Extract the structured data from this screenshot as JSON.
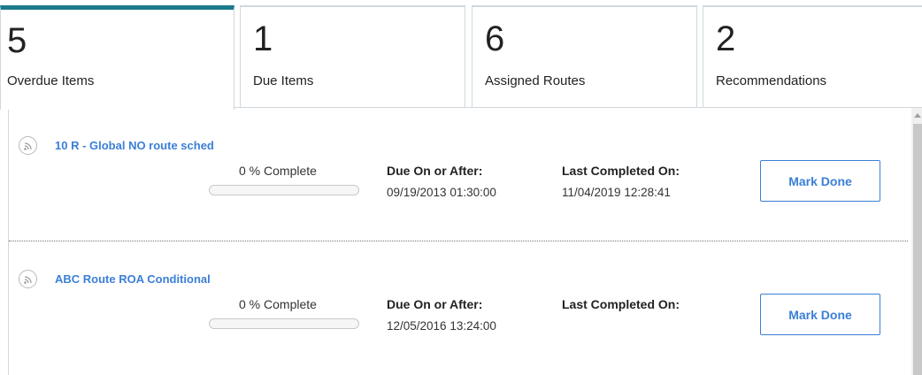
{
  "tabs": [
    {
      "count": "5",
      "label": "Overdue Items",
      "active": true
    },
    {
      "count": "1",
      "label": "Due Items",
      "active": false
    },
    {
      "count": "6",
      "label": "Assigned Routes",
      "active": false
    },
    {
      "count": "2",
      "label": "Recommendations",
      "active": false
    }
  ],
  "items": [
    {
      "icon": "route-icon",
      "title": "10 R - Global NO route sched",
      "progress_percent": 0,
      "progress_text": "0 %  Complete",
      "due_label": "Due On or After:",
      "due_value": "09/19/2013 01:30:00",
      "last_label": "Last Completed On:",
      "last_value": "11/04/2019 12:28:41",
      "button_label": "Mark Done"
    },
    {
      "icon": "route-icon",
      "title": "ABC Route ROA Conditional",
      "progress_percent": 0,
      "progress_text": "0 %  Complete",
      "due_label": "Due On or After:",
      "due_value": "12/05/2016 13:24:00",
      "last_label": "Last Completed On:",
      "last_value": "",
      "button_label": "Mark Done"
    }
  ],
  "colors": {
    "accent": "#3b7fd6",
    "active_tab": "#1d7a8c",
    "border": "#cfd8de"
  }
}
